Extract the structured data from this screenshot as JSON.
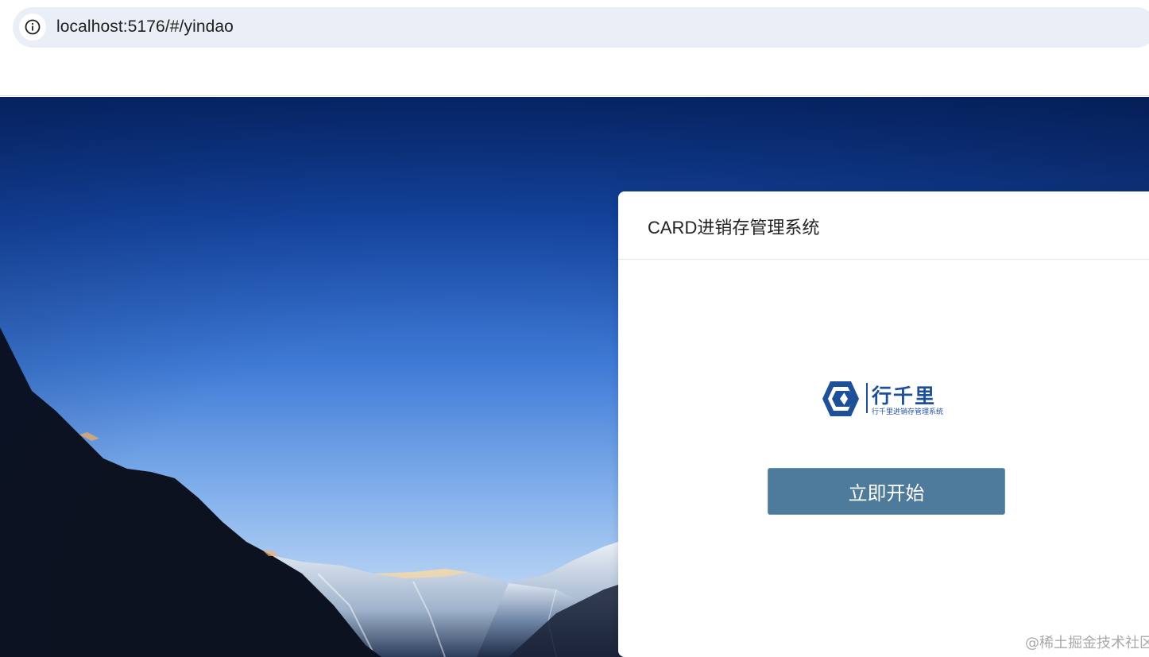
{
  "browser": {
    "url": "localhost:5176/#/yindao",
    "site_info_icon": "info-icon"
  },
  "card": {
    "title": "CARD进销存管理系统",
    "logo": {
      "main_text": "行千里",
      "sub_text": "行千里进销存管理系统",
      "icon": "hexagon-logo-icon",
      "color": "#1e4f99"
    },
    "start_button_label": "立即开始",
    "start_button_color": "#4e7a9c"
  },
  "watermark": "@稀土掘金技术社区"
}
